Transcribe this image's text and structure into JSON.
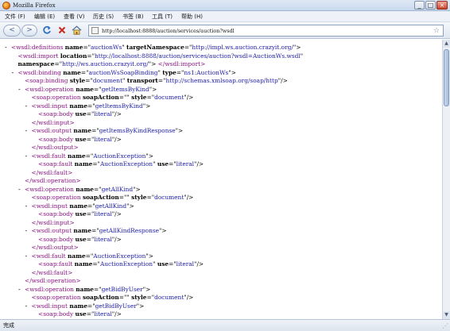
{
  "window": {
    "title": "Mozilla Firefox",
    "controls": [
      "_",
      "□",
      "×"
    ]
  },
  "menu": {
    "items": [
      "文件 (F)",
      "编辑 (E)",
      "查看 (V)",
      "历史 (S)",
      "书签 (B)",
      "工具 (T)",
      "帮助 (H)"
    ]
  },
  "nav": {
    "back_glyph": "<",
    "forward_glyph": ">",
    "url": "http://localhost:8888/auction/services/auction?wsdl",
    "star_glyph": "☆"
  },
  "xml": {
    "lines": [
      {
        "fold": "-",
        "indent": 0,
        "parts": [
          [
            "tag",
            "<wsdl:definitions "
          ],
          [
            "attr",
            "name"
          ],
          [
            "txt",
            "=\""
          ],
          [
            "val",
            "auctionWs"
          ],
          [
            "txt",
            "\" "
          ],
          [
            "attr",
            "targetNamespace"
          ],
          [
            "txt",
            "=\""
          ],
          [
            "val",
            "http://impl.ws.auction.crazyit.org/"
          ],
          [
            "txt",
            "\">"
          ]
        ]
      },
      {
        "fold": "",
        "indent": 1,
        "parts": [
          [
            "tag",
            "<wsdl:import "
          ],
          [
            "attr",
            "location"
          ],
          [
            "txt",
            "=\""
          ],
          [
            "val",
            "http://localhost:8888/auction/services/auction?wsdl=AuctionWs.wsdl"
          ],
          [
            "txt",
            "\""
          ]
        ]
      },
      {
        "fold": "",
        "indent": 1,
        "parts": [
          [
            "attr",
            "namespace"
          ],
          [
            "txt",
            "=\""
          ],
          [
            "val",
            "http://ws.auction.crazyit.org/"
          ],
          [
            "txt",
            "\"> "
          ],
          [
            "tag",
            "</wsdl:import>"
          ]
        ]
      },
      {
        "fold": "-",
        "indent": 1,
        "parts": [
          [
            "tag",
            "<wsdl:binding "
          ],
          [
            "attr",
            "name"
          ],
          [
            "txt",
            "=\""
          ],
          [
            "val",
            "auctionWsSoapBinding"
          ],
          [
            "txt",
            "\" "
          ],
          [
            "attr",
            "type"
          ],
          [
            "txt",
            "=\""
          ],
          [
            "val",
            "ns1:AuctionWs"
          ],
          [
            "txt",
            "\">"
          ]
        ]
      },
      {
        "fold": "",
        "indent": 2,
        "parts": [
          [
            "tag",
            "<soap:binding "
          ],
          [
            "attr",
            "style"
          ],
          [
            "txt",
            "=\""
          ],
          [
            "val",
            "document"
          ],
          [
            "txt",
            "\" "
          ],
          [
            "attr",
            "transport"
          ],
          [
            "txt",
            "=\""
          ],
          [
            "val",
            "http://schemas.xmlsoap.org/soap/http"
          ],
          [
            "txt",
            "\"/>"
          ]
        ]
      },
      {
        "fold": "-",
        "indent": 2,
        "parts": [
          [
            "tag",
            "<wsdl:operation "
          ],
          [
            "attr",
            "name"
          ],
          [
            "txt",
            "=\""
          ],
          [
            "val",
            "getItemsByKind"
          ],
          [
            "txt",
            "\">"
          ]
        ]
      },
      {
        "fold": "",
        "indent": 3,
        "parts": [
          [
            "tag",
            "<soap:operation "
          ],
          [
            "attr",
            "soapAction"
          ],
          [
            "txt",
            "=\"\" "
          ],
          [
            "attr",
            "style"
          ],
          [
            "txt",
            "=\""
          ],
          [
            "val",
            "document"
          ],
          [
            "txt",
            "\"/>"
          ]
        ]
      },
      {
        "fold": "-",
        "indent": 3,
        "parts": [
          [
            "tag",
            "<wsdl:input "
          ],
          [
            "attr",
            "name"
          ],
          [
            "txt",
            "=\""
          ],
          [
            "val",
            "getItemsByKind"
          ],
          [
            "txt",
            "\">"
          ]
        ]
      },
      {
        "fold": "",
        "indent": 4,
        "parts": [
          [
            "tag",
            "<soap:body "
          ],
          [
            "attr",
            "use"
          ],
          [
            "txt",
            "=\""
          ],
          [
            "val",
            "literal"
          ],
          [
            "txt",
            "\"/>"
          ]
        ]
      },
      {
        "fold": "",
        "indent": 3,
        "parts": [
          [
            "tag",
            "</wsdl:input>"
          ]
        ]
      },
      {
        "fold": "-",
        "indent": 3,
        "parts": [
          [
            "tag",
            "<wsdl:output "
          ],
          [
            "attr",
            "name"
          ],
          [
            "txt",
            "=\""
          ],
          [
            "val",
            "getItemsByKindResponse"
          ],
          [
            "txt",
            "\">"
          ]
        ]
      },
      {
        "fold": "",
        "indent": 4,
        "parts": [
          [
            "tag",
            "<soap:body "
          ],
          [
            "attr",
            "use"
          ],
          [
            "txt",
            "=\""
          ],
          [
            "val",
            "literal"
          ],
          [
            "txt",
            "\"/>"
          ]
        ]
      },
      {
        "fold": "",
        "indent": 3,
        "parts": [
          [
            "tag",
            "</wsdl:output>"
          ]
        ]
      },
      {
        "fold": "-",
        "indent": 3,
        "parts": [
          [
            "tag",
            "<wsdl:fault "
          ],
          [
            "attr",
            "name"
          ],
          [
            "txt",
            "=\""
          ],
          [
            "val",
            "AuctionException"
          ],
          [
            "txt",
            "\">"
          ]
        ]
      },
      {
        "fold": "",
        "indent": 4,
        "parts": [
          [
            "tag",
            "<soap:fault "
          ],
          [
            "attr",
            "name"
          ],
          [
            "txt",
            "=\""
          ],
          [
            "val",
            "AuctionException"
          ],
          [
            "txt",
            "\" "
          ],
          [
            "attr",
            "use"
          ],
          [
            "txt",
            "=\""
          ],
          [
            "val",
            "literal"
          ],
          [
            "txt",
            "\"/>"
          ]
        ]
      },
      {
        "fold": "",
        "indent": 3,
        "parts": [
          [
            "tag",
            "</wsdl:fault>"
          ]
        ]
      },
      {
        "fold": "",
        "indent": 2,
        "parts": [
          [
            "tag",
            "</wsdl:operation>"
          ]
        ]
      },
      {
        "fold": "-",
        "indent": 2,
        "parts": [
          [
            "tag",
            "<wsdl:operation "
          ],
          [
            "attr",
            "name"
          ],
          [
            "txt",
            "=\""
          ],
          [
            "val",
            "getAllKind"
          ],
          [
            "txt",
            "\">"
          ]
        ]
      },
      {
        "fold": "",
        "indent": 3,
        "parts": [
          [
            "tag",
            "<soap:operation "
          ],
          [
            "attr",
            "soapAction"
          ],
          [
            "txt",
            "=\"\" "
          ],
          [
            "attr",
            "style"
          ],
          [
            "txt",
            "=\""
          ],
          [
            "val",
            "document"
          ],
          [
            "txt",
            "\"/>"
          ]
        ]
      },
      {
        "fold": "-",
        "indent": 3,
        "parts": [
          [
            "tag",
            "<wsdl:input "
          ],
          [
            "attr",
            "name"
          ],
          [
            "txt",
            "=\""
          ],
          [
            "val",
            "getAllKind"
          ],
          [
            "txt",
            "\">"
          ]
        ]
      },
      {
        "fold": "",
        "indent": 4,
        "parts": [
          [
            "tag",
            "<soap:body "
          ],
          [
            "attr",
            "use"
          ],
          [
            "txt",
            "=\""
          ],
          [
            "val",
            "literal"
          ],
          [
            "txt",
            "\"/>"
          ]
        ]
      },
      {
        "fold": "",
        "indent": 3,
        "parts": [
          [
            "tag",
            "</wsdl:input>"
          ]
        ]
      },
      {
        "fold": "-",
        "indent": 3,
        "parts": [
          [
            "tag",
            "<wsdl:output "
          ],
          [
            "attr",
            "name"
          ],
          [
            "txt",
            "=\""
          ],
          [
            "val",
            "getAllKindResponse"
          ],
          [
            "txt",
            "\">"
          ]
        ]
      },
      {
        "fold": "",
        "indent": 4,
        "parts": [
          [
            "tag",
            "<soap:body "
          ],
          [
            "attr",
            "use"
          ],
          [
            "txt",
            "=\""
          ],
          [
            "val",
            "literal"
          ],
          [
            "txt",
            "\"/>"
          ]
        ]
      },
      {
        "fold": "",
        "indent": 3,
        "parts": [
          [
            "tag",
            "</wsdl:output>"
          ]
        ]
      },
      {
        "fold": "-",
        "indent": 3,
        "parts": [
          [
            "tag",
            "<wsdl:fault "
          ],
          [
            "attr",
            "name"
          ],
          [
            "txt",
            "=\""
          ],
          [
            "val",
            "AuctionException"
          ],
          [
            "txt",
            "\">"
          ]
        ]
      },
      {
        "fold": "",
        "indent": 4,
        "parts": [
          [
            "tag",
            "<soap:fault "
          ],
          [
            "attr",
            "name"
          ],
          [
            "txt",
            "=\""
          ],
          [
            "val",
            "AuctionException"
          ],
          [
            "txt",
            "\" "
          ],
          [
            "attr",
            "use"
          ],
          [
            "txt",
            "=\""
          ],
          [
            "val",
            "literal"
          ],
          [
            "txt",
            "\"/>"
          ]
        ]
      },
      {
        "fold": "",
        "indent": 3,
        "parts": [
          [
            "tag",
            "</wsdl:fault>"
          ]
        ]
      },
      {
        "fold": "",
        "indent": 2,
        "parts": [
          [
            "tag",
            "</wsdl:operation>"
          ]
        ]
      },
      {
        "fold": "-",
        "indent": 2,
        "parts": [
          [
            "tag",
            "<wsdl:operation "
          ],
          [
            "attr",
            "name"
          ],
          [
            "txt",
            "=\""
          ],
          [
            "val",
            "getBidByUser"
          ],
          [
            "txt",
            "\">"
          ]
        ]
      },
      {
        "fold": "",
        "indent": 3,
        "parts": [
          [
            "tag",
            "<soap:operation "
          ],
          [
            "attr",
            "soapAction"
          ],
          [
            "txt",
            "=\"\" "
          ],
          [
            "attr",
            "style"
          ],
          [
            "txt",
            "=\""
          ],
          [
            "val",
            "document"
          ],
          [
            "txt",
            "\"/>"
          ]
        ]
      },
      {
        "fold": "-",
        "indent": 3,
        "parts": [
          [
            "tag",
            "<wsdl:input "
          ],
          [
            "attr",
            "name"
          ],
          [
            "txt",
            "=\""
          ],
          [
            "val",
            "getBidByUser"
          ],
          [
            "txt",
            "\">"
          ]
        ]
      },
      {
        "fold": "",
        "indent": 4,
        "parts": [
          [
            "tag",
            "<soap:body "
          ],
          [
            "attr",
            "use"
          ],
          [
            "txt",
            "=\""
          ],
          [
            "val",
            "literal"
          ],
          [
            "txt",
            "\"/>"
          ]
        ]
      }
    ]
  },
  "status": {
    "text": "完成"
  },
  "scrollbar": {
    "up_glyph": "▲",
    "down_glyph": "▼",
    "position": 0.0
  },
  "colors": {
    "tag": "#881280",
    "attr": "#000000",
    "value": "#1a1aa6"
  }
}
